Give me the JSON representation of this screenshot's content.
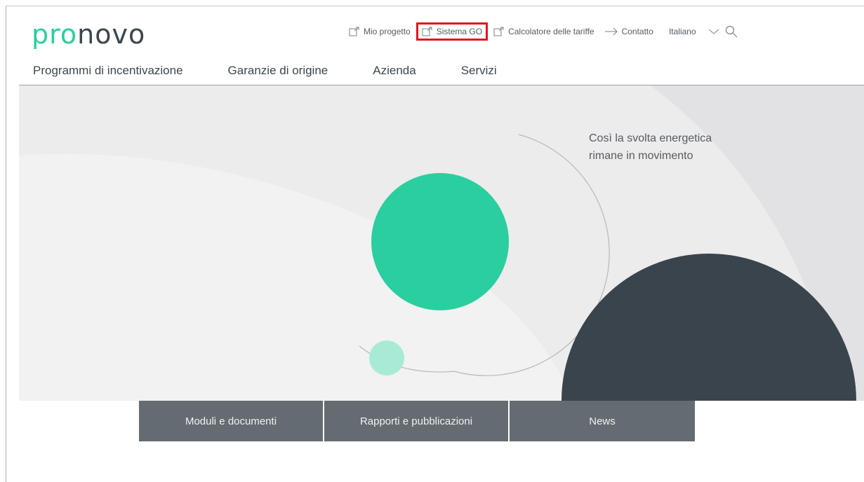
{
  "logo": {
    "part1": "pro",
    "part2": "novo"
  },
  "toplinks": [
    {
      "label": "Mio progetto",
      "icon": "external-link-icon"
    },
    {
      "label": "Sistema GO",
      "icon": "external-link-icon",
      "highlighted": true
    },
    {
      "label": "Calcolatore delle tariffe",
      "icon": "external-link-icon"
    },
    {
      "label": "Contatto",
      "icon": "arrow-right-icon"
    }
  ],
  "language": {
    "selected": "Italiano",
    "icon": "chevron-down-icon"
  },
  "search": {
    "icon": "search-icon"
  },
  "mainnav": [
    {
      "label": "Programmi di incentivazione"
    },
    {
      "label": "Garanzie di origine"
    },
    {
      "label": "Azienda"
    },
    {
      "label": "Servizi"
    }
  ],
  "hero": {
    "tagline": "Così la svolta energetica\nrimane in movimento"
  },
  "tiles": [
    {
      "label": "Moduli e documenti"
    },
    {
      "label": "Rapporti e pubblicazioni"
    },
    {
      "label": "News"
    }
  ],
  "colors": {
    "brand_green": "#2bce9f",
    "dark": "#3a444c",
    "tile": "#646b71",
    "highlight": "#e3151a"
  }
}
